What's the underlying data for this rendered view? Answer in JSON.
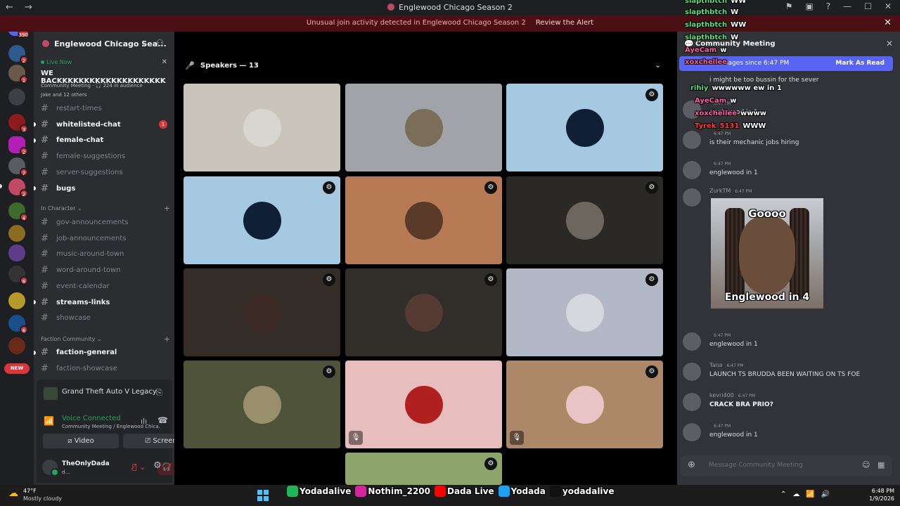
{
  "window": {
    "title": "Englewood Chicago Season 2",
    "nav_arrows": "← →",
    "buttons": [
      "⚑",
      "▣",
      "?",
      "—",
      "☐",
      "✕"
    ]
  },
  "alert": {
    "message": "Unusual join activity detected in Englewood Chicago Season 2",
    "action": "Review the Alert",
    "close": "✕"
  },
  "rail": {
    "mention_count": "390",
    "badges": [
      "2",
      "1",
      "3",
      "2",
      "7",
      "2",
      "4",
      "6",
      "6"
    ],
    "new_label": "NEW"
  },
  "guild": {
    "name": "Englewood Chicago Sea...",
    "chevron": "⌄",
    "add_user": "⚇"
  },
  "live": {
    "label": "Live Now",
    "close": "✕",
    "title": "WE BACKKKKKKKKKKKKKKKKKKKK",
    "subtitle": "Community Meeting · 🎧 224 in audience",
    "participants": "Jake and 12 others"
  },
  "channels_top": [
    {
      "name": "restart-times",
      "unread": false,
      "count": ""
    },
    {
      "name": "whitelisted-chat",
      "unread": true,
      "count": "1"
    },
    {
      "name": "female-chat",
      "unread": true,
      "count": ""
    },
    {
      "name": "female-suggestions",
      "unread": false,
      "count": ""
    },
    {
      "name": "server-suggestions",
      "unread": false,
      "count": ""
    },
    {
      "name": "bugs",
      "unread": true,
      "count": ""
    }
  ],
  "category_in_character": "In Character",
  "channels_ic": [
    {
      "name": "gov-announcements",
      "unread": false
    },
    {
      "name": "job-announcements",
      "unread": false
    },
    {
      "name": "music-around-town",
      "unread": false
    },
    {
      "name": "word-around-town",
      "unread": false
    },
    {
      "name": "event-calendar",
      "unread": false
    },
    {
      "name": "streams-links",
      "unread": true
    },
    {
      "name": "showcase",
      "unread": false
    }
  ],
  "category_faction": "Faction Community",
  "channels_faction": [
    {
      "name": "faction-general",
      "unread": true
    },
    {
      "name": "faction-showcase",
      "unread": false
    }
  ],
  "activity": {
    "name": "Grand Theft Auto V Legacy"
  },
  "voice": {
    "status": "Voice Connected",
    "location": "Community Meeting / Englewood Chica...",
    "video_label": "Video",
    "screen_label": "Screen"
  },
  "user": {
    "name": "TheOnlyDada",
    "status": "d..."
  },
  "stage": {
    "speakers_label": "Speakers — 13",
    "tiles": [
      {
        "bg": "#c9c5ba",
        "av": "#d8d6d0",
        "badge": false,
        "muted": false
      },
      {
        "bg": "#a0a3a8",
        "av": "#7a6e58",
        "badge": false,
        "muted": false
      },
      {
        "bg": "#a6c9e2",
        "av": "#0f1f36",
        "badge": true,
        "muted": false
      },
      {
        "bg": "#a6c9e2",
        "av": "#0f1f36",
        "badge": true,
        "muted": false
      },
      {
        "bg": "#b77a55",
        "av": "#5a3b2a",
        "badge": true,
        "muted": false
      },
      {
        "bg": "#2b2926",
        "av": "#6c665e",
        "badge": true,
        "muted": false
      },
      {
        "bg": "#332c27",
        "av": "#3b2a24",
        "badge": true,
        "muted": false
      },
      {
        "bg": "#312d29",
        "av": "#553b34",
        "badge": true,
        "muted": false
      },
      {
        "bg": "#b3b8c6",
        "av": "#d6d6de",
        "badge": true,
        "muted": false
      },
      {
        "bg": "#4e5339",
        "av": "#9a8f6c",
        "badge": true,
        "muted": false
      },
      {
        "bg": "#e7bdbd",
        "av": "#b02020",
        "badge": false,
        "muted": true
      },
      {
        "bg": "#ad8868",
        "av": "#e9c4c4",
        "badge": true,
        "muted": true
      },
      {
        "bg": "#8da46a",
        "av": "#8da46a",
        "badge": true,
        "muted": false
      }
    ]
  },
  "chat": {
    "title": "Community Meeting",
    "close": "✕",
    "new_messages": "70 new messages since 6:47 PM",
    "mark_read": "Mark As Read",
    "messages": [
      {
        "name": "",
        "time": "",
        "text": "i might be too bussin for the sever",
        "bold": false,
        "av": false
      },
      {
        "name": "",
        "time": "6:47 PM",
        "text": "englewood in 1",
        "bold": false,
        "av": true
      },
      {
        "name": "",
        "time": "6:47 PM",
        "text": "is their mechanic jobs hiring",
        "bold": false,
        "av": true
      },
      {
        "name": "",
        "time": "6:47 PM",
        "text": "englewood in 1",
        "bold": false,
        "av": true
      },
      {
        "name": "ZurkTM",
        "time": "6:47 PM",
        "text": "",
        "bold": false,
        "av": true
      },
      {
        "name": "",
        "time": "6:47 PM",
        "text": "englewood in 1",
        "bold": false,
        "av": true
      },
      {
        "name": "Tana",
        "time": "6:47 PM",
        "text": "LAUNCH TS BRUDDA BEEN WAITING ON TS FOE",
        "bold": false,
        "av": true
      },
      {
        "name": "kevri400",
        "time": "6:47 PM",
        "text": "CRACK BRA PRIO?",
        "bold": true,
        "av": true
      },
      {
        "name": "",
        "time": "6:47 PM",
        "text": "englewood in 1",
        "bold": false,
        "av": true
      }
    ],
    "meme_top": "Goooo",
    "meme_bottom": "Englewood in 4",
    "placeholder": "Message Community Meeting"
  },
  "overlay": [
    {
      "user": "slapthbtch",
      "text": "WW",
      "color": "green"
    },
    {
      "user": "slapthbtch",
      "text": "W",
      "color": "green"
    },
    {
      "user": "slapthbtch",
      "text": "WW",
      "color": "green"
    },
    {
      "user": "slapthbtch",
      "text": "W",
      "color": "green"
    },
    {
      "user": "AyeCam",
      "text": "w",
      "color": "pink"
    },
    {
      "user": "xoxchellee",
      "text": "",
      "color": "pink"
    },
    {
      "user": "rihiy",
      "text": "wwwwww ew in 1",
      "color": "green"
    },
    {
      "user": "AyeCam",
      "text": "w",
      "color": "pink"
    },
    {
      "user": "xoxchellee",
      "text": "wwww",
      "color": "pink"
    },
    {
      "user": "Tyrek_5131",
      "text": "WWW",
      "color": "red"
    }
  ],
  "socials": [
    {
      "name": "Yodadalive",
      "color": "#1db954"
    },
    {
      "name": "Nothim_2200",
      "color": "#d6249f"
    },
    {
      "name": "Dada Live",
      "color": "#ff0000"
    },
    {
      "name": "Yodada",
      "color": "#1da1f2"
    },
    {
      "name": "yodadalive",
      "color": "#111111"
    }
  ],
  "taskbar": {
    "temp": "47°F",
    "condition": "Mostly cloudy",
    "time": "6:48 PM",
    "date": "1/9/2026"
  }
}
